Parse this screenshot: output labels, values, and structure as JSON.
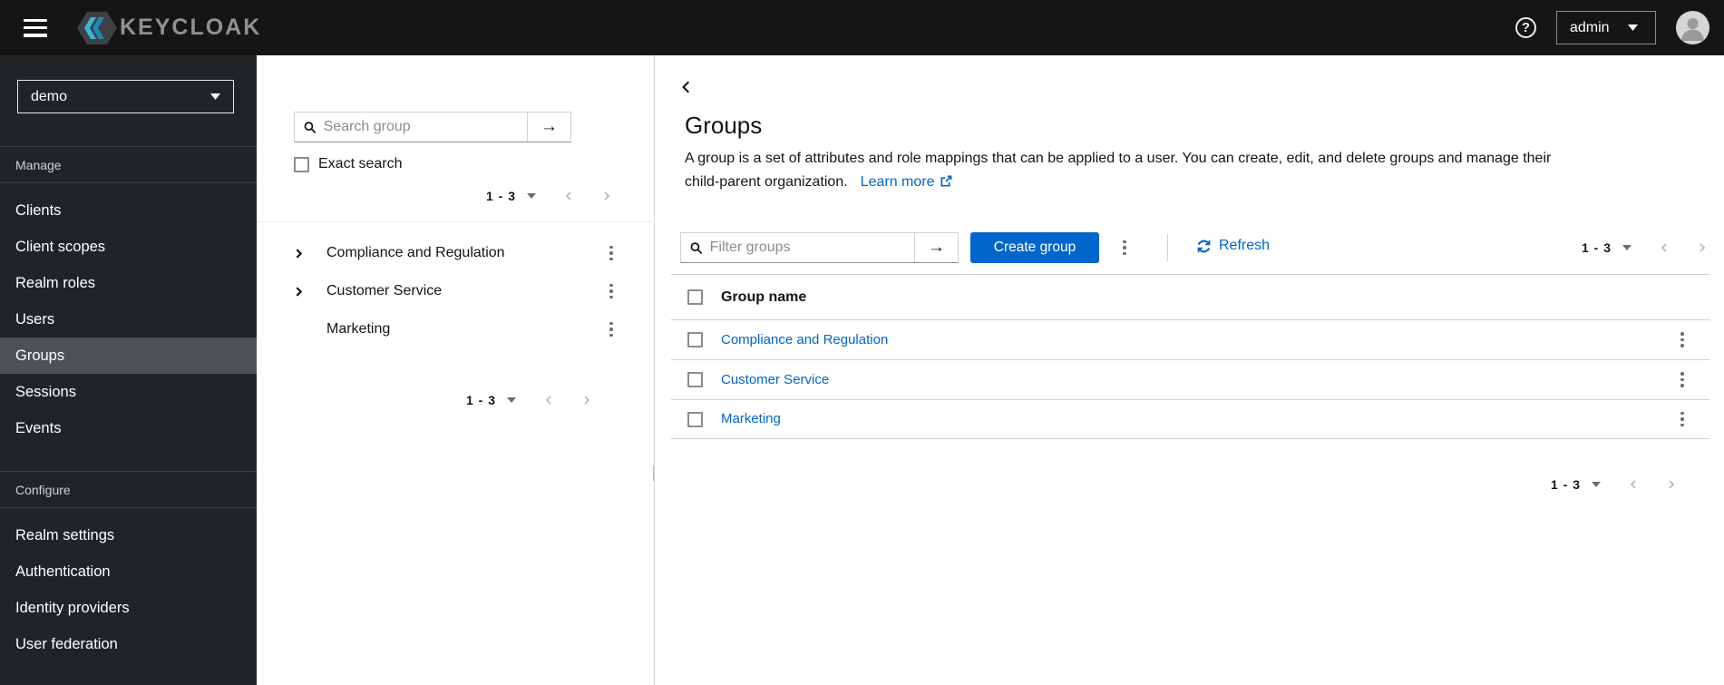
{
  "topbar": {
    "brand": "KEYCLOAK",
    "help_icon": "?",
    "username": "admin"
  },
  "sidebar": {
    "realm": "demo",
    "sections": [
      {
        "title": "Manage",
        "items": [
          {
            "label": "Clients"
          },
          {
            "label": "Client scopes"
          },
          {
            "label": "Realm roles"
          },
          {
            "label": "Users"
          },
          {
            "label": "Groups",
            "active": true
          },
          {
            "label": "Sessions"
          },
          {
            "label": "Events"
          }
        ]
      },
      {
        "title": "Configure",
        "items": [
          {
            "label": "Realm settings"
          },
          {
            "label": "Authentication"
          },
          {
            "label": "Identity providers"
          },
          {
            "label": "User federation"
          }
        ]
      }
    ]
  },
  "group_panel": {
    "search_placeholder": "Search group",
    "exact_search_label": "Exact search",
    "pagination_range": "1 - 3",
    "tree": [
      {
        "label": "Compliance and Regulation",
        "expandable": true
      },
      {
        "label": "Customer Service",
        "expandable": true
      },
      {
        "label": "Marketing",
        "expandable": false
      }
    ]
  },
  "main": {
    "title": "Groups",
    "description_line1": "A group is a set of attributes and role mappings that can be applied to a user. You can create, edit, and delete groups and manage their",
    "description_line2": "child-parent organization.",
    "learn_more_label": "Learn more",
    "toolbar": {
      "filter_placeholder": "Filter groups",
      "create_button_label": "Create group",
      "refresh_label": "Refresh",
      "pagination_range": "1 - 3"
    },
    "table": {
      "header": "Group name",
      "rows": [
        {
          "name": "Compliance and Regulation"
        },
        {
          "name": "Customer Service"
        },
        {
          "name": "Marketing"
        }
      ]
    },
    "bottom_pagination_range": "1 - 3"
  },
  "colors": {
    "masthead_bg": "#151515",
    "sidebar_bg": "#212427",
    "sidebar_active_bg": "#4f5255",
    "accent_blue": "#0066cc",
    "border_light": "#d2d2d2",
    "border_dark": "#8a8d90"
  }
}
